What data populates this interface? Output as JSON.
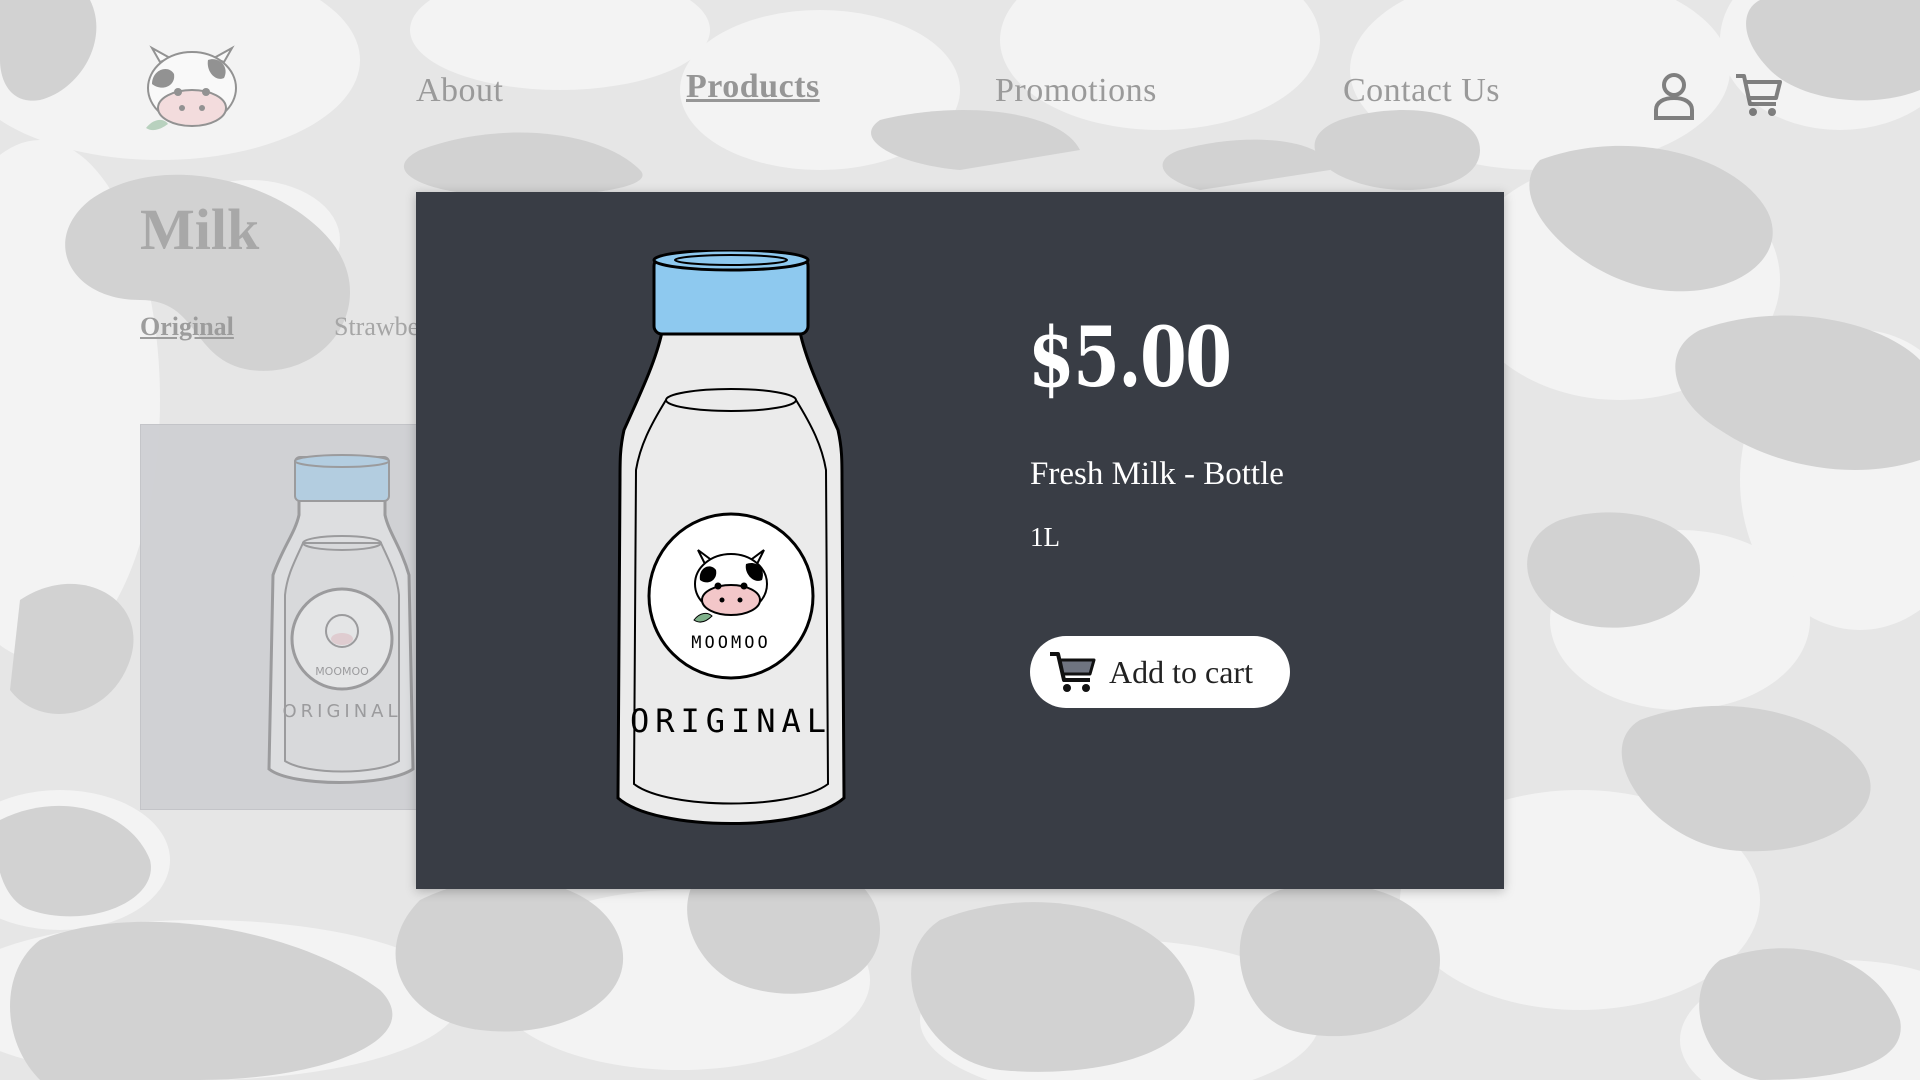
{
  "header": {
    "logo": "cow-face-logo",
    "nav": [
      {
        "label": "About",
        "active": false
      },
      {
        "label": "Products",
        "active": true
      },
      {
        "label": "Promotions",
        "active": false
      },
      {
        "label": "Contact Us",
        "active": false
      }
    ],
    "icons": [
      "account-icon",
      "cart-icon"
    ]
  },
  "page": {
    "title": "Milk",
    "subtabs": [
      {
        "label": "Original",
        "active": true
      },
      {
        "label": "Strawberry",
        "active": false
      }
    ],
    "card": {
      "bottle_brand": "MOOMOO",
      "bottle_label": "ORIGINAL"
    }
  },
  "modal": {
    "price": "$5.00",
    "name": "Fresh Milk - Bottle",
    "size": "1L",
    "bottle_brand": "MOOMOO",
    "bottle_label": "ORIGINAL",
    "add_button": {
      "label": "Add to cart",
      "icon": "cart-icon"
    }
  },
  "colors": {
    "page_background": "#e6e6e6",
    "cow_spots": "#d2d2d2",
    "modal_background": "#393d45",
    "bottle_cap": "#8ec9ef",
    "bottle_body": "#ebebeb",
    "button_background": "#ffffff"
  }
}
